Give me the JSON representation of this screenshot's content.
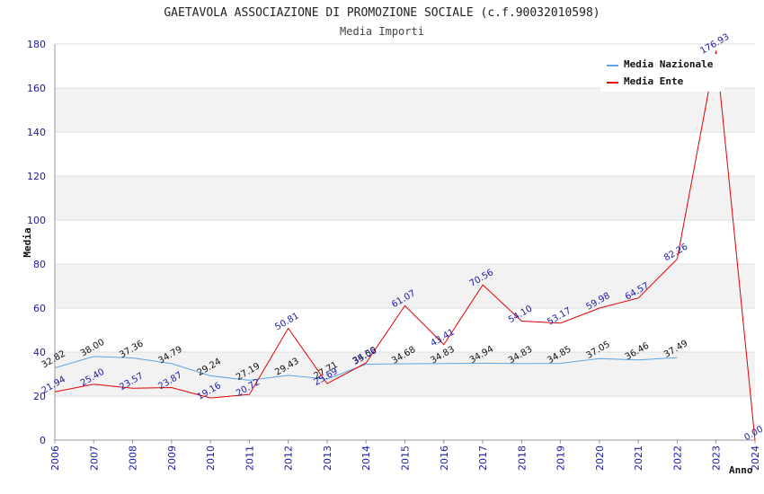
{
  "chart_data": {
    "type": "line",
    "title": "GAETAVOLA ASSOCIAZIONE DI PROMOZIONE SOCIALE (c.f.90032010598)",
    "subtitle": "Media Importi",
    "xlabel": "Anno",
    "ylabel": "Media",
    "ylim": [
      0,
      180
    ],
    "yticks": [
      "0",
      "20",
      "40",
      "60",
      "80",
      "100",
      "120",
      "140",
      "160",
      "180"
    ],
    "categories": [
      "2006",
      "2007",
      "2008",
      "2009",
      "2010",
      "2011",
      "2012",
      "2013",
      "2014",
      "2015",
      "2016",
      "2017",
      "2018",
      "2019",
      "2020",
      "2021",
      "2022",
      "2023",
      "2024"
    ],
    "grid": true,
    "legend_position": "top-right",
    "series": [
      {
        "name": "Media Nazionale",
        "color": "#5aa6e6",
        "values": [
          32.82,
          38.0,
          37.36,
          34.79,
          29.24,
          27.19,
          29.43,
          27.71,
          34.5,
          34.68,
          34.83,
          34.94,
          34.83,
          34.85,
          37.05,
          36.46,
          37.49,
          null,
          null
        ],
        "labels": [
          "32.82",
          "38.00",
          "37.36",
          "34.79",
          "29.24",
          "27.19",
          "29.43",
          "27.71",
          "34.50",
          "34.68",
          "34.83",
          "34.94",
          "34.83",
          "34.85",
          "37.05",
          "36.46",
          "37.49",
          "",
          ""
        ]
      },
      {
        "name": "Media Ente",
        "color": "#e00000",
        "values": [
          21.94,
          25.4,
          23.57,
          23.87,
          19.16,
          20.72,
          50.81,
          25.69,
          35.06,
          61.07,
          43.41,
          70.56,
          54.1,
          53.17,
          59.98,
          64.57,
          82.26,
          176.93,
          0.0
        ],
        "labels": [
          "21.94",
          "25.40",
          "23.57",
          "23.87",
          "19.16",
          "20.72",
          "50.81",
          "25.69",
          "35.06",
          "61.07",
          "43.41",
          "70.56",
          "54.10",
          "53.17",
          "59.98",
          "64.57",
          "82.26",
          "176.93",
          "0.00"
        ]
      }
    ]
  }
}
